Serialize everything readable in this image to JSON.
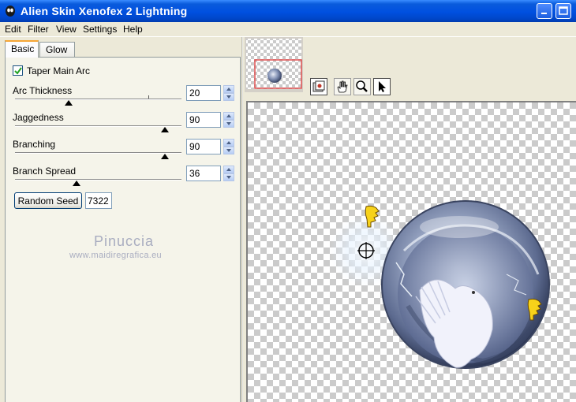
{
  "window": {
    "title": "Alien Skin Xenofex 2 Lightning"
  },
  "menu": [
    "Edit",
    "Filter",
    "View",
    "Settings",
    "Help"
  ],
  "tabs": [
    {
      "label": "Basic",
      "active": true
    },
    {
      "label": "Glow",
      "active": false
    }
  ],
  "taper_main_arc": {
    "label": "Taper Main Arc",
    "checked": true
  },
  "sliders": [
    {
      "label": "Arc Thickness",
      "value": "20",
      "level": 0.3
    },
    {
      "label": "Jaggedness",
      "value": "90",
      "level": 0.9
    },
    {
      "label": "Branching",
      "value": "90",
      "level": 0.9
    },
    {
      "label": "Branch Spread",
      "value": "36",
      "level": 0.36
    }
  ],
  "random_seed": {
    "button_label": "Random Seed",
    "value": "7322"
  },
  "watermark": {
    "name": "Pinuccia",
    "site": "www.maidiregrafica.eu"
  },
  "tools": [
    "preview-toggle-icon",
    "hand-icon",
    "zoom-icon",
    "arrow-pointer-icon"
  ],
  "colors": {
    "titlebar": "#0050e0",
    "tab_highlight": "#f6a636",
    "thumbnail_frame": "#e05050"
  }
}
